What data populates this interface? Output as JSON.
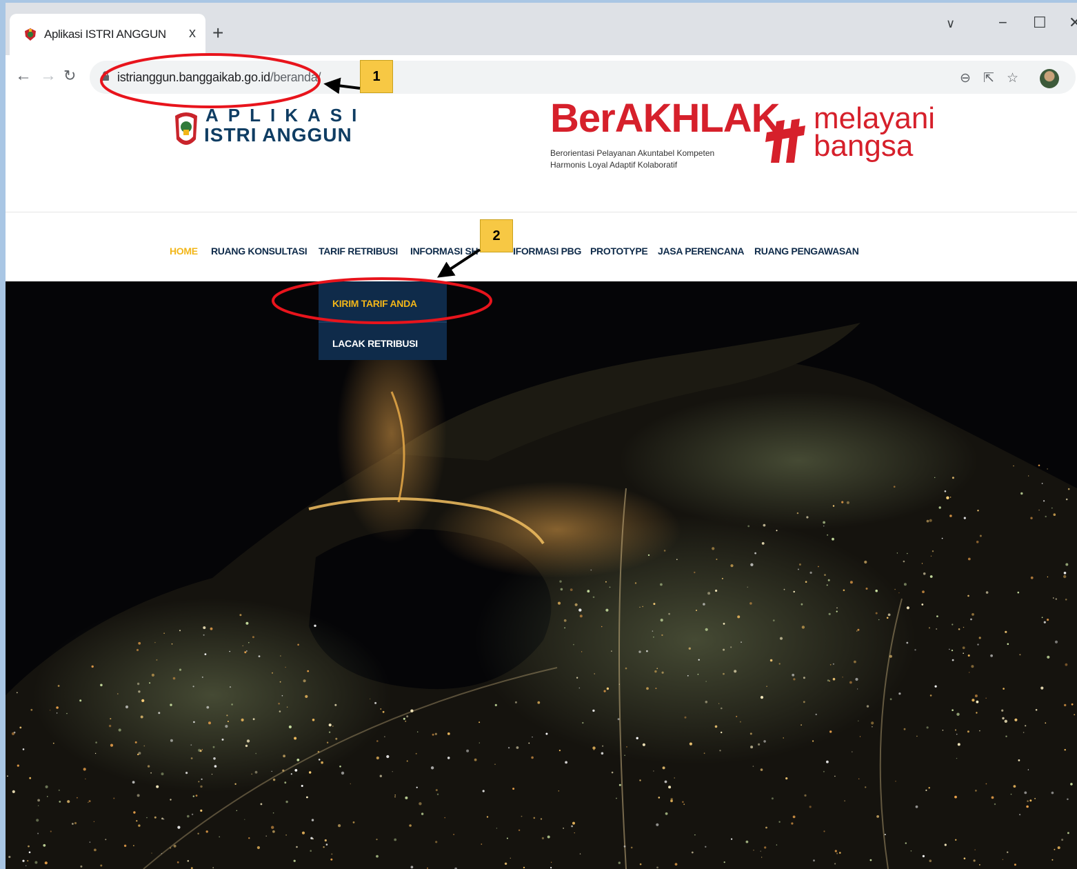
{
  "browser": {
    "tab_title": "Aplikasi ISTRI ANGGUN",
    "tab_close": "x",
    "new_tab": "+",
    "window_controls": [
      "∨",
      "−",
      "☐",
      "✕"
    ],
    "url_host": "istrianggun.banggaikab.go.id",
    "url_path": "/beranda/",
    "toolbar_icons": [
      "zoom-icon",
      "share-icon",
      "star-icon",
      "profile-avatar",
      "menu-icon"
    ]
  },
  "header": {
    "logo_line1": "APLIKASI",
    "logo_line2": "ISTRI ANGGUN",
    "berakhlak_title": "BerAKHLAK",
    "berakhlak_sub1": "Berorientasi Pelayanan Akuntabel Kompeten",
    "berakhlak_sub2": "Harmonis Loyal Adaptif Kolaboratif",
    "tagline1": "melayani",
    "tagline2": "bangsa"
  },
  "menu": {
    "items": [
      {
        "label": "HOME",
        "active": true
      },
      {
        "label": "RUANG KONSULTASI"
      },
      {
        "label": "TARIF RETRIBUSI"
      },
      {
        "label": "INFORMASI SH"
      },
      {
        "label": "IFORMASI PBG"
      },
      {
        "label": "PROTOTYPE"
      },
      {
        "label": "JASA PERENCANA"
      },
      {
        "label": "RUANG PENGAWASAN"
      }
    ],
    "dropdown": [
      "KIRIM TARIF ANDA",
      "LACAK RETRIBUSI"
    ]
  },
  "annotations": {
    "badge1": "1",
    "badge2": "2"
  },
  "colors": {
    "menu_active": "#f2b619",
    "menu_text": "#0f2b4a",
    "dropdown_bg": "#0f2b4a",
    "brand_red": "#d6202b",
    "annotation_red": "#e8141c",
    "badge_yellow": "#f7c844"
  }
}
